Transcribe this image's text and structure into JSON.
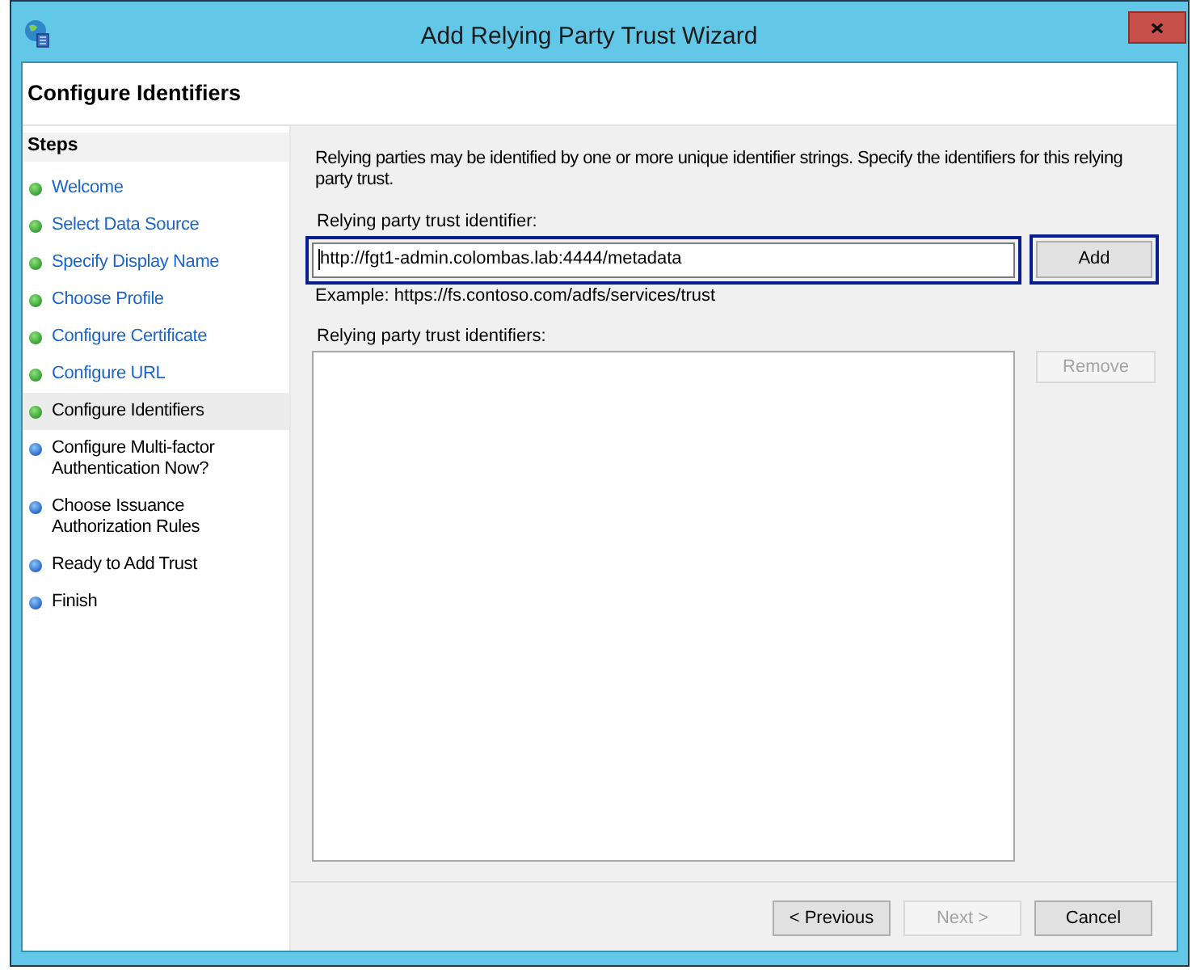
{
  "window": {
    "title": "Add Relying Party Trust Wizard"
  },
  "page_header": {
    "title": "Configure Identifiers"
  },
  "steps": {
    "heading": "Steps",
    "items": [
      {
        "label": "Welcome",
        "completed": true,
        "selected": false
      },
      {
        "label": "Select Data Source",
        "completed": true,
        "selected": false
      },
      {
        "label": "Specify Display Name",
        "completed": true,
        "selected": false
      },
      {
        "label": "Choose Profile",
        "completed": true,
        "selected": false
      },
      {
        "label": "Configure Certificate",
        "completed": true,
        "selected": false
      },
      {
        "label": "Configure URL",
        "completed": true,
        "selected": false
      },
      {
        "label": "Configure Identifiers",
        "completed": true,
        "selected": true
      },
      {
        "label": "Configure Multi-factor Authentication Now?",
        "completed": false,
        "selected": false
      },
      {
        "label": "Choose Issuance Authorization Rules",
        "completed": false,
        "selected": false
      },
      {
        "label": "Ready to Add Trust",
        "completed": false,
        "selected": false
      },
      {
        "label": "Finish",
        "completed": false,
        "selected": false
      }
    ]
  },
  "content": {
    "description": "Relying parties may be identified by one or more unique identifier strings. Specify the identifiers for this relying party trust.",
    "identifier_label": "Relying party trust identifier:",
    "identifier_field": {
      "value": "http://fgt1-admin.colombas.lab:4444/metadata",
      "focused": true,
      "highlighted": true
    },
    "add_button": {
      "label": "Add",
      "disabled": false,
      "highlighted": true
    },
    "example": "Example: https://fs.contoso.com/adfs/services/trust",
    "list_label": "Relying party trust identifiers:",
    "remove_button": {
      "label": "Remove",
      "disabled": true
    }
  },
  "footer_buttons": [
    {
      "label": "< Previous",
      "disabled": false
    },
    {
      "label": "Next >",
      "disabled": true
    },
    {
      "label": "Cancel",
      "disabled": false
    }
  ]
}
